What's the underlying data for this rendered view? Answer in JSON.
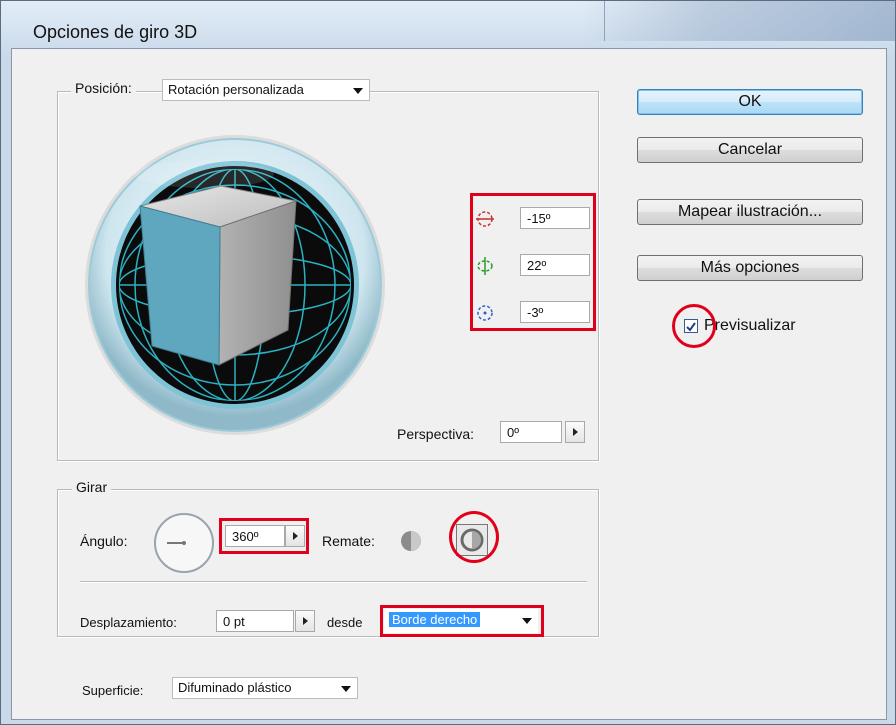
{
  "window": {
    "title": "Opciones de giro 3D"
  },
  "position": {
    "label": "Posición:",
    "label_mnemonic": "n",
    "value": "Rotación personalizada",
    "rotation_x": "-15º",
    "rotation_y": "22º",
    "rotation_z": "-3º",
    "perspective_label": "Perspectiva:",
    "perspective_value": "0º"
  },
  "revolve": {
    "group_title": "Girar",
    "angle_label": "Ángulo:",
    "angle_value": "360º",
    "cap_label": "Remate:",
    "offset_label": "Desplazamiento:",
    "offset_value": "0 pt",
    "from_label": "desde",
    "from_value": "Borde derecho"
  },
  "surface": {
    "label": "Superficie:",
    "value": "Difuminado plástico"
  },
  "buttons": {
    "ok": "OK",
    "cancel": "Cancelar",
    "map_art": "Mapear ilustración...",
    "more_options": "Más opciones"
  },
  "preview": {
    "label": "Previsualizar",
    "checked": true
  },
  "colors": {
    "highlight_red": "#e0001a",
    "cube_front": "#5ea7be",
    "track_cyan": "#2ec4d8",
    "selection_blue": "#3399ff"
  }
}
